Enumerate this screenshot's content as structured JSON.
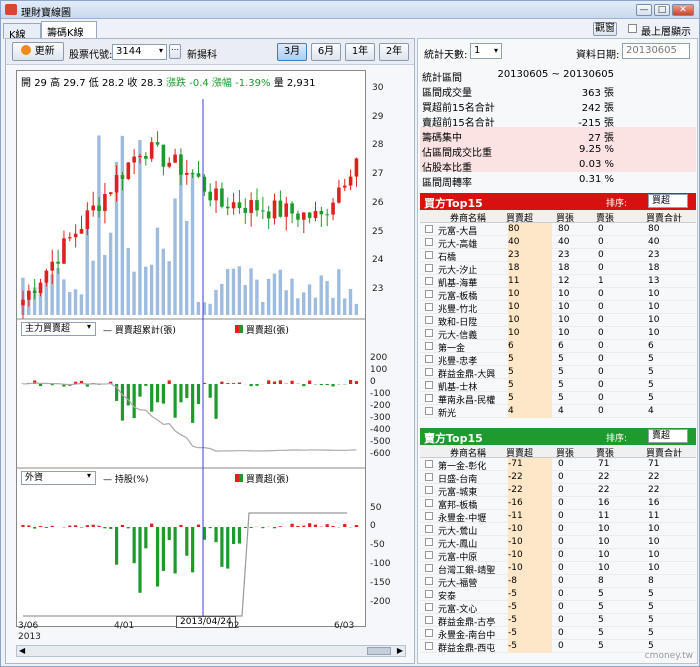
{
  "window": {
    "title": "理財寶線圖",
    "close_label": "✕",
    "min_label": "—",
    "max_label": "□"
  },
  "tabs": [
    {
      "label": "K線圖"
    },
    {
      "label": "籌碼K線圖"
    }
  ],
  "top": {
    "layout_btn": "觀窗",
    "always_top": "最上層顯示"
  },
  "toolbar": {
    "update": "更新",
    "stock_code_label": "股票代號:",
    "stock_code": "3144",
    "stock_name": "新揚科",
    "ranges": [
      "3月",
      "6月",
      "1年",
      "2年"
    ],
    "selected_range": "3月"
  },
  "right_toolbar": {
    "days_label": "統計天數:",
    "days_value": "1",
    "date_label": "資料日期:",
    "date_value": "20130605"
  },
  "ohlc": {
    "open_label": "開",
    "open": "29",
    "high_label": "高",
    "high": "29.7",
    "low_label": "低",
    "low": "28.2",
    "close_label": "收",
    "close": "28.3",
    "chg_label": "漲跌",
    "chg": "-0.4",
    "pct_label": "漲幅",
    "pct": "-1.39%",
    "vol_label": "量",
    "vol": "2,931"
  },
  "price_axis": [
    "30",
    "29",
    "28",
    "27",
    "26",
    "25",
    "24",
    "23"
  ],
  "panel2": {
    "select": "主力買賣超",
    "legend1": "買賣超累計(張)",
    "legend2": "買賣超(張)",
    "axis": [
      "200",
      "100",
      "0",
      "-100",
      "-200",
      "-300",
      "-400",
      "-500",
      "-600"
    ]
  },
  "panel3": {
    "select": "外資",
    "legend1": "持股(%)",
    "legend2": "買賣超(張)",
    "axis": [
      "50",
      "0",
      "-50",
      "-100",
      "-150",
      "-200"
    ]
  },
  "x_axis": {
    "labels": [
      "3/06",
      "2013",
      "4/01",
      "02",
      "6/03"
    ],
    "crosshair": "2013/04/24"
  },
  "stats": [
    {
      "k": "統計區間",
      "v": "20130605 ~ 20130605"
    },
    {
      "k": "區間成交量",
      "v": "363 張"
    },
    {
      "k": "買超前15名合計",
      "v": "242 張"
    },
    {
      "k": "賣超前15名合計",
      "v": "-215 張"
    },
    {
      "k": "籌碼集中",
      "v": "27 張"
    },
    {
      "k": "佔區間成交比重",
      "v": "9.25 %"
    },
    {
      "k": "佔股本比重",
      "v": "0.03 %"
    },
    {
      "k": "區間周轉率",
      "v": "0.31 %"
    }
  ],
  "buy_section": {
    "title": "買方Top15",
    "sort_label": "排序:",
    "sort_value": "買超",
    "color": "#d81010"
  },
  "sell_section": {
    "title": "賣方Top15",
    "sort_label": "排序:",
    "sort_value": "賣超",
    "color": "#1f9a2f"
  },
  "table_headers": [
    "券商名稱",
    "買賣超",
    "買張",
    "賣張",
    "買賣合計"
  ],
  "buy_rows": [
    [
      "元富-大昌",
      "80",
      "80",
      "0",
      "80"
    ],
    [
      "元大-高雄",
      "40",
      "40",
      "0",
      "40"
    ],
    [
      "石橋",
      "23",
      "23",
      "0",
      "23"
    ],
    [
      "元大-汐止",
      "18",
      "18",
      "0",
      "18"
    ],
    [
      "凱基-海華",
      "11",
      "12",
      "1",
      "13"
    ],
    [
      "元富-板橋",
      "10",
      "10",
      "0",
      "10"
    ],
    [
      "兆豐-竹北",
      "10",
      "10",
      "0",
      "10"
    ],
    [
      "致和-日陞",
      "10",
      "10",
      "0",
      "10"
    ],
    [
      "元大-信義",
      "10",
      "10",
      "0",
      "10"
    ],
    [
      "第一金",
      "6",
      "6",
      "0",
      "6"
    ],
    [
      "兆豐-忠孝",
      "5",
      "5",
      "0",
      "5"
    ],
    [
      "群益金鼎-大興",
      "5",
      "5",
      "0",
      "5"
    ],
    [
      "凱基-士林",
      "5",
      "5",
      "0",
      "5"
    ],
    [
      "華南永昌-民權",
      "5",
      "5",
      "0",
      "5"
    ],
    [
      "新光",
      "4",
      "4",
      "0",
      "4"
    ]
  ],
  "sell_rows": [
    [
      "第一金-彰化",
      "-71",
      "0",
      "71",
      "71"
    ],
    [
      "日盛-台南",
      "-22",
      "0",
      "22",
      "22"
    ],
    [
      "元富-城東",
      "-22",
      "0",
      "22",
      "22"
    ],
    [
      "富邦-板橋",
      "-16",
      "0",
      "16",
      "16"
    ],
    [
      "永豐金-中壢",
      "-11",
      "0",
      "11",
      "11"
    ],
    [
      "元大-鶯山",
      "-10",
      "0",
      "10",
      "10"
    ],
    [
      "元大-鳳山",
      "-10",
      "0",
      "10",
      "10"
    ],
    [
      "元富-中原",
      "-10",
      "0",
      "10",
      "10"
    ],
    [
      "台灣工銀-靖聖",
      "-10",
      "0",
      "10",
      "10"
    ],
    [
      "元大-福營",
      "-8",
      "0",
      "8",
      "8"
    ],
    [
      "安泰",
      "-5",
      "0",
      "5",
      "5"
    ],
    [
      "元富-文心",
      "-5",
      "0",
      "5",
      "5"
    ],
    [
      "群益金鼎-古亭",
      "-5",
      "0",
      "5",
      "5"
    ],
    [
      "永豐金-南台中",
      "-5",
      "0",
      "5",
      "5"
    ],
    [
      "群益金鼎-西屯",
      "-5",
      "0",
      "5",
      "5"
    ]
  ],
  "watermark": "cmoney.tw",
  "colors": {
    "up": "#e0201c",
    "down": "#1d9a2a",
    "volume": "#9ebbe0",
    "buy_header": "#d81010",
    "sell_header": "#1f9a2f"
  }
}
